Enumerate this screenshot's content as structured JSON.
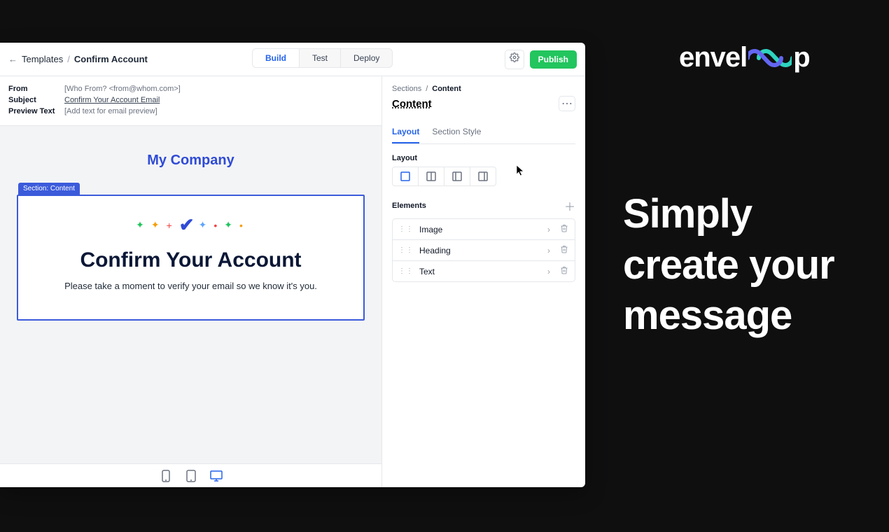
{
  "header": {
    "back_label": "Templates",
    "title": "Confirm Account",
    "tabs": {
      "build": "Build",
      "test": "Test",
      "deploy": "Deploy"
    },
    "publish": "Publish"
  },
  "meta": {
    "from_label": "From",
    "from_value": "[Who From? <from@whom.com>]",
    "subject_label": "Subject",
    "subject_value": "Confirm Your Account Email",
    "preview_label": "Preview Text",
    "preview_value": "[Add text for email preview]"
  },
  "canvas": {
    "company": "My Company",
    "section_chip": "Section: Content",
    "heading": "Confirm Your Account",
    "lead": "Please take a moment to verify your email so we know it's you."
  },
  "side": {
    "crumb_root": "Sections",
    "crumb_current": "Content",
    "title": "Content",
    "tabs": {
      "layout": "Layout",
      "section_style": "Section Style"
    },
    "layout_label": "Layout",
    "elements_label": "Elements",
    "elements": [
      {
        "label": "Image"
      },
      {
        "label": "Heading"
      },
      {
        "label": "Text"
      }
    ]
  },
  "marketing": {
    "brand": "envel",
    "brand_suffix": "p",
    "tagline": "Simply create your message"
  }
}
